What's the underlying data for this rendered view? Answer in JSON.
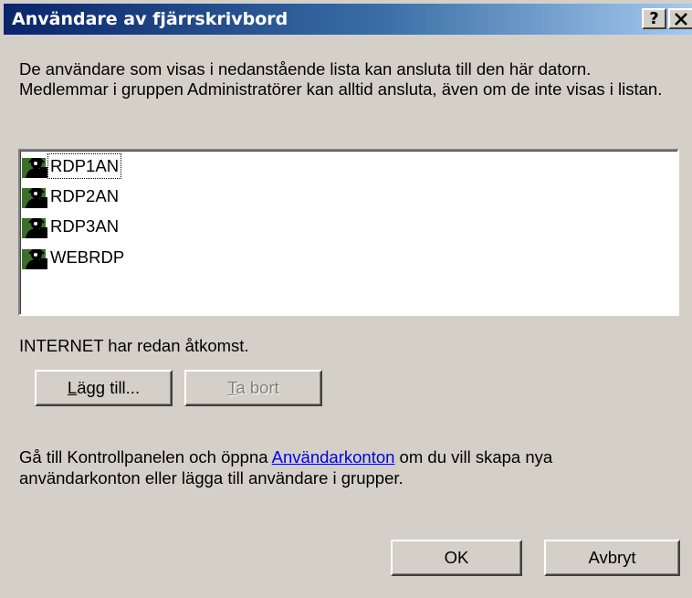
{
  "window": {
    "title": "Användare av fjärrskrivbord",
    "help_button": "?",
    "close_button": "×"
  },
  "intro_text": "De användare som visas i nedanstående lista kan ansluta till den här datorn. Medlemmar i gruppen Administratörer kan alltid ansluta, även om de inte visas i listan.",
  "user_list": {
    "items": [
      {
        "label": "RDP1AN",
        "icon": "user-icon"
      },
      {
        "label": "RDP2AN",
        "icon": "user-icon"
      },
      {
        "label": "RDP3AN",
        "icon": "user-icon"
      },
      {
        "label": "WEBRDP",
        "icon": "user-icon"
      }
    ]
  },
  "status_text": "INTERNET har redan åtkomst.",
  "buttons": {
    "add_accel": "L",
    "add_rest": "ägg till...",
    "remove_accel": "T",
    "remove_rest": "a bort",
    "ok": "OK",
    "cancel": "Avbryt"
  },
  "footer": {
    "before_link": "Gå till Kontrollpanelen och öppna ",
    "link": "Användarkonton",
    "after_link": " om du vill skapa nya användarkonton eller lägga till användare i grupper."
  }
}
